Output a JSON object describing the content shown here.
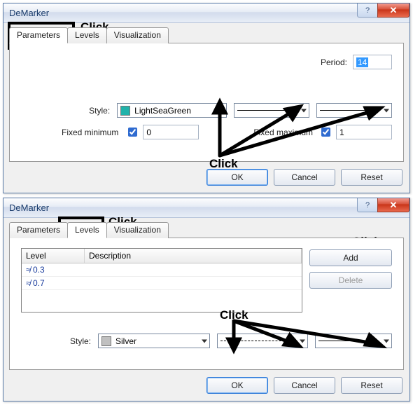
{
  "dialog1": {
    "title": "DeMarker",
    "tabs": {
      "parameters": "Parameters",
      "levels": "Levels",
      "visualization": "Visualization"
    },
    "period_label": "Period:",
    "period_value": "14",
    "style_label": "Style:",
    "color_name": "LightSeaGreen",
    "color_hex": "#20B2AA",
    "fixed_min_label": "Fixed minimum",
    "fixed_min_value": "0",
    "fixed_max_label": "Fixed maximum",
    "fixed_max_value": "1",
    "ok": "OK",
    "cancel": "Cancel",
    "reset": "Reset",
    "ann_top": "Click",
    "ann_mid": "Click"
  },
  "dialog2": {
    "title": "DeMarker",
    "tabs": {
      "parameters": "Parameters",
      "levels": "Levels",
      "visualization": "Visualization"
    },
    "col_level": "Level",
    "col_desc": "Description",
    "rows": [
      {
        "level": "0.3",
        "desc": ""
      },
      {
        "level": "0.7",
        "desc": ""
      }
    ],
    "add": "Add",
    "delete": "Delete",
    "style_label": "Style:",
    "color_name": "Silver",
    "color_hex": "#C0C0C0",
    "ok": "OK",
    "cancel": "Cancel",
    "reset": "Reset",
    "ann_top": "Click",
    "ann_add": "Click",
    "ann_mid": "Click"
  }
}
